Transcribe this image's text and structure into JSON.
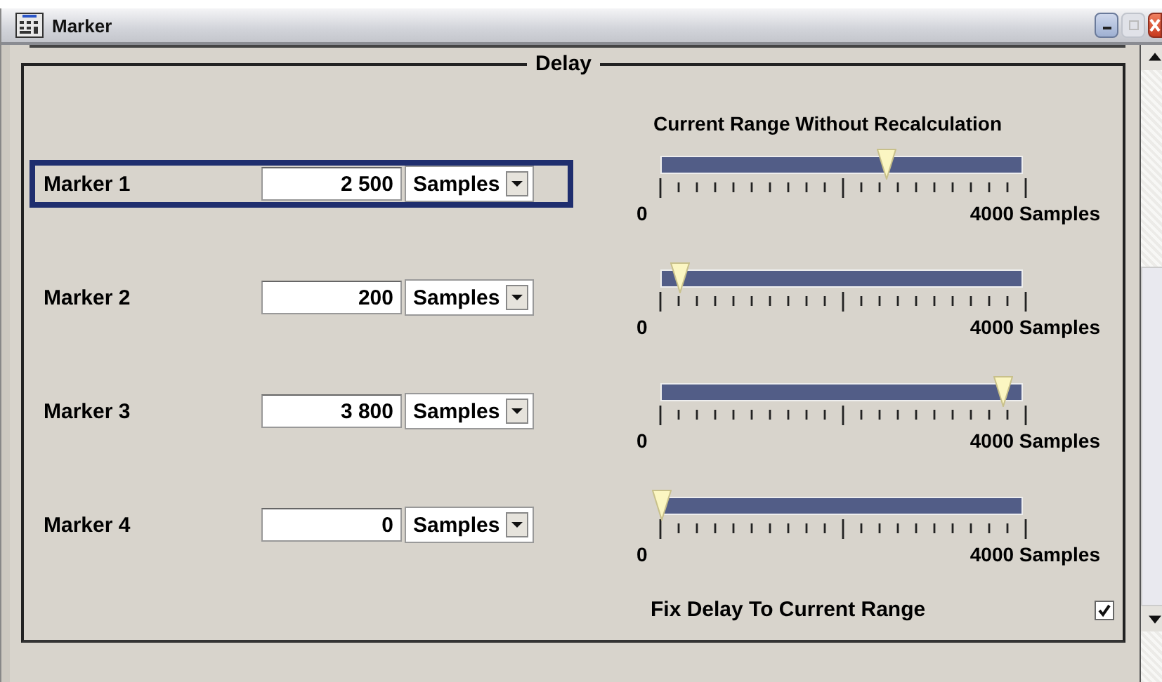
{
  "window": {
    "title": "Marker"
  },
  "group": {
    "title": "Delay",
    "range_heading": "Current Range Without Recalculation"
  },
  "markers": [
    {
      "label": "Marker 1",
      "value": "2 500",
      "unit": "Samples",
      "selected": true,
      "level": 0.625,
      "scale_min": "0",
      "scale_max": "4000 Samples"
    },
    {
      "label": "Marker 2",
      "value": "200",
      "unit": "Samples",
      "selected": false,
      "level": 0.05,
      "scale_min": "0",
      "scale_max": "4000 Samples"
    },
    {
      "label": "Marker 3",
      "value": "3 800",
      "unit": "Samples",
      "selected": false,
      "level": 0.95,
      "scale_min": "0",
      "scale_max": "4000 Samples"
    },
    {
      "label": "Marker 4",
      "value": "0",
      "unit": "Samples",
      "selected": false,
      "level": 0,
      "scale_min": "0",
      "scale_max": "4000 Samples"
    }
  ],
  "fix_delay": {
    "label": "Fix Delay To Current Range",
    "checked": true
  }
}
